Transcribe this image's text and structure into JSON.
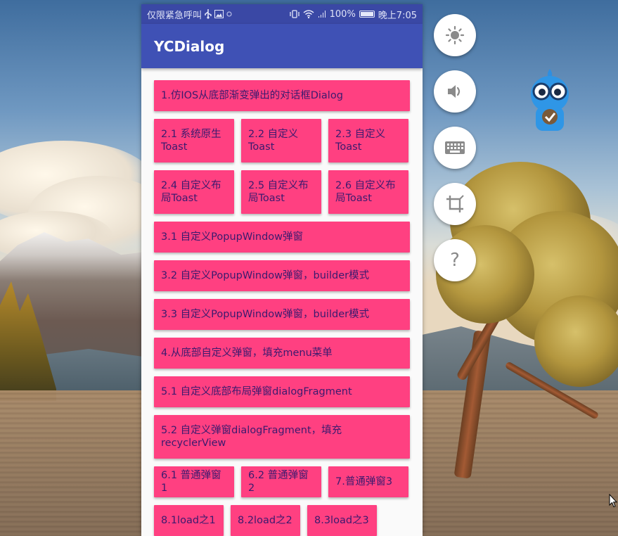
{
  "status_bar": {
    "left_text": "仅限紧急呼叫",
    "battery_percent": "100%",
    "time": "晚上7:05"
  },
  "app_bar": {
    "title": "YCDialog"
  },
  "buttons": {
    "b1": "1.仿IOS从底部渐变弹出的对话框Dialog",
    "b2_1": "2.1 系统原生Toast",
    "b2_2": "2.2 自定义Toast",
    "b2_3": "2.3 自定义Toast",
    "b2_4": "2.4 自定义布局Toast",
    "b2_5": "2.5 自定义布局Toast",
    "b2_6": "2.6 自定义布局Toast",
    "b3_1": "3.1 自定义PopupWindow弹窗",
    "b3_2": "3.2 自定义PopupWindow弹窗，builder模式",
    "b3_3": "3.3 自定义PopupWindow弹窗，builder模式",
    "b4": "4.从底部自定义弹窗，填充menu菜单",
    "b5_1": "5.1 自定义底部布局弹窗dialogFragment",
    "b5_2": "5.2 自定义弹窗dialogFragment，填充recyclerView",
    "b6_1": "6.1 普通弹窗1",
    "b6_2": "6.2 普通弹窗2",
    "b7": "7.普通弹窗3",
    "b8_1": "8.1load之1",
    "b8_2": "8.2load之2",
    "b8_3": "8.3load之3"
  },
  "toolbar": {
    "help_glyph": "?"
  },
  "colors": {
    "primary": "#3f51b5",
    "primary_dark": "#3a48a5",
    "accent": "#ff4081",
    "button_text": "#3b1a6e"
  }
}
